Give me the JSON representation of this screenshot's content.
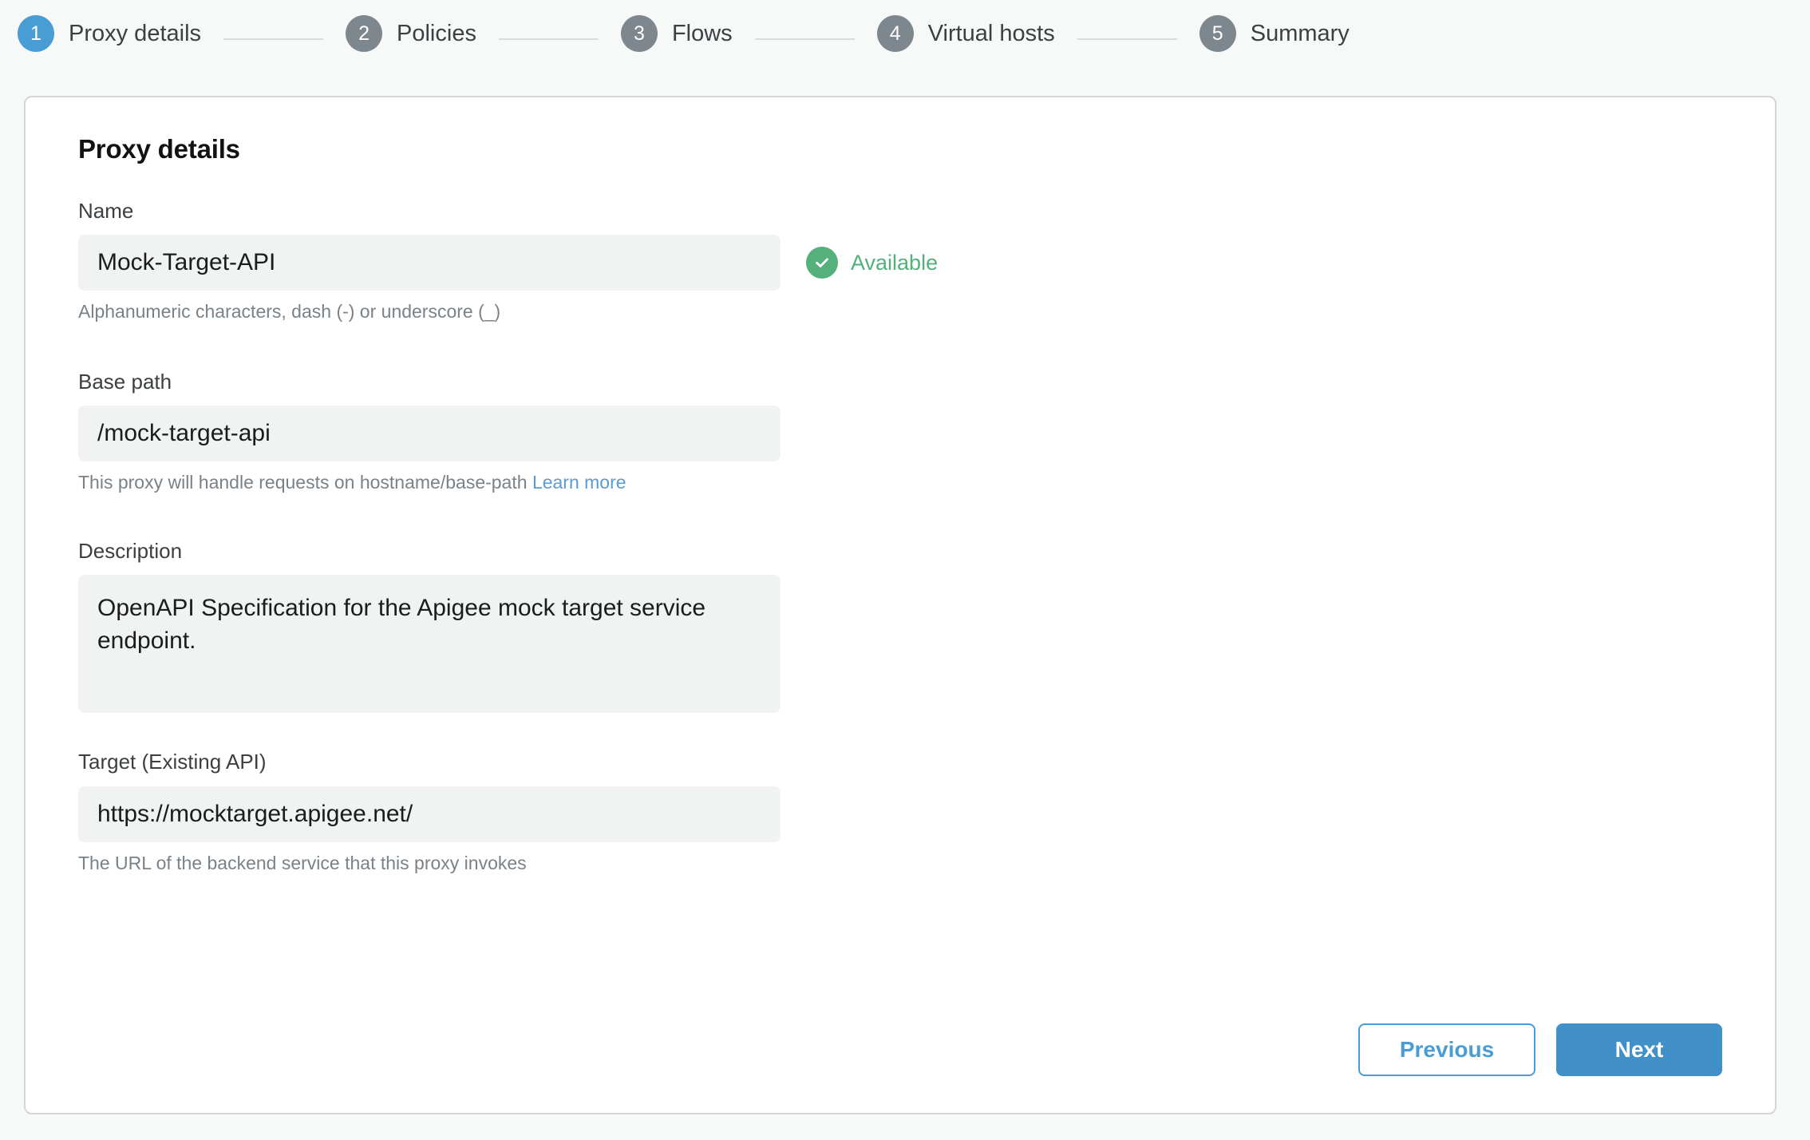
{
  "stepper": {
    "steps": [
      {
        "number": "1",
        "label": "Proxy details",
        "state": "active"
      },
      {
        "number": "2",
        "label": "Policies",
        "state": "inactive"
      },
      {
        "number": "3",
        "label": "Flows",
        "state": "inactive"
      },
      {
        "number": "4",
        "label": "Virtual hosts",
        "state": "inactive"
      },
      {
        "number": "5",
        "label": "Summary",
        "state": "inactive"
      }
    ],
    "active_color": "#4A9CD4",
    "inactive_color": "#7E878E"
  },
  "card": {
    "title": "Proxy details",
    "fields": {
      "name": {
        "label": "Name",
        "value": "Mock-Target-API",
        "helper": "Alphanumeric characters, dash (-) or underscore (_)"
      },
      "base_path": {
        "label": "Base path",
        "value": "/mock-target-api",
        "helper": "This proxy will handle requests on hostname/base-path",
        "helper_link": "Learn more"
      },
      "description": {
        "label": "Description",
        "value": "OpenAPI Specification for the Apigee mock target service endpoint."
      },
      "target": {
        "label": "Target (Existing API)",
        "value": "https://mocktarget.apigee.net/",
        "helper": "The URL of the backend service that this proxy invokes"
      }
    },
    "availability": {
      "icon": "check-circle-icon",
      "text": "Available",
      "color": "#54AF7B"
    }
  },
  "footer": {
    "previous_label": "Previous",
    "next_label": "Next",
    "primary_color": "#4191C8",
    "secondary_color": "#4A9CD4"
  }
}
